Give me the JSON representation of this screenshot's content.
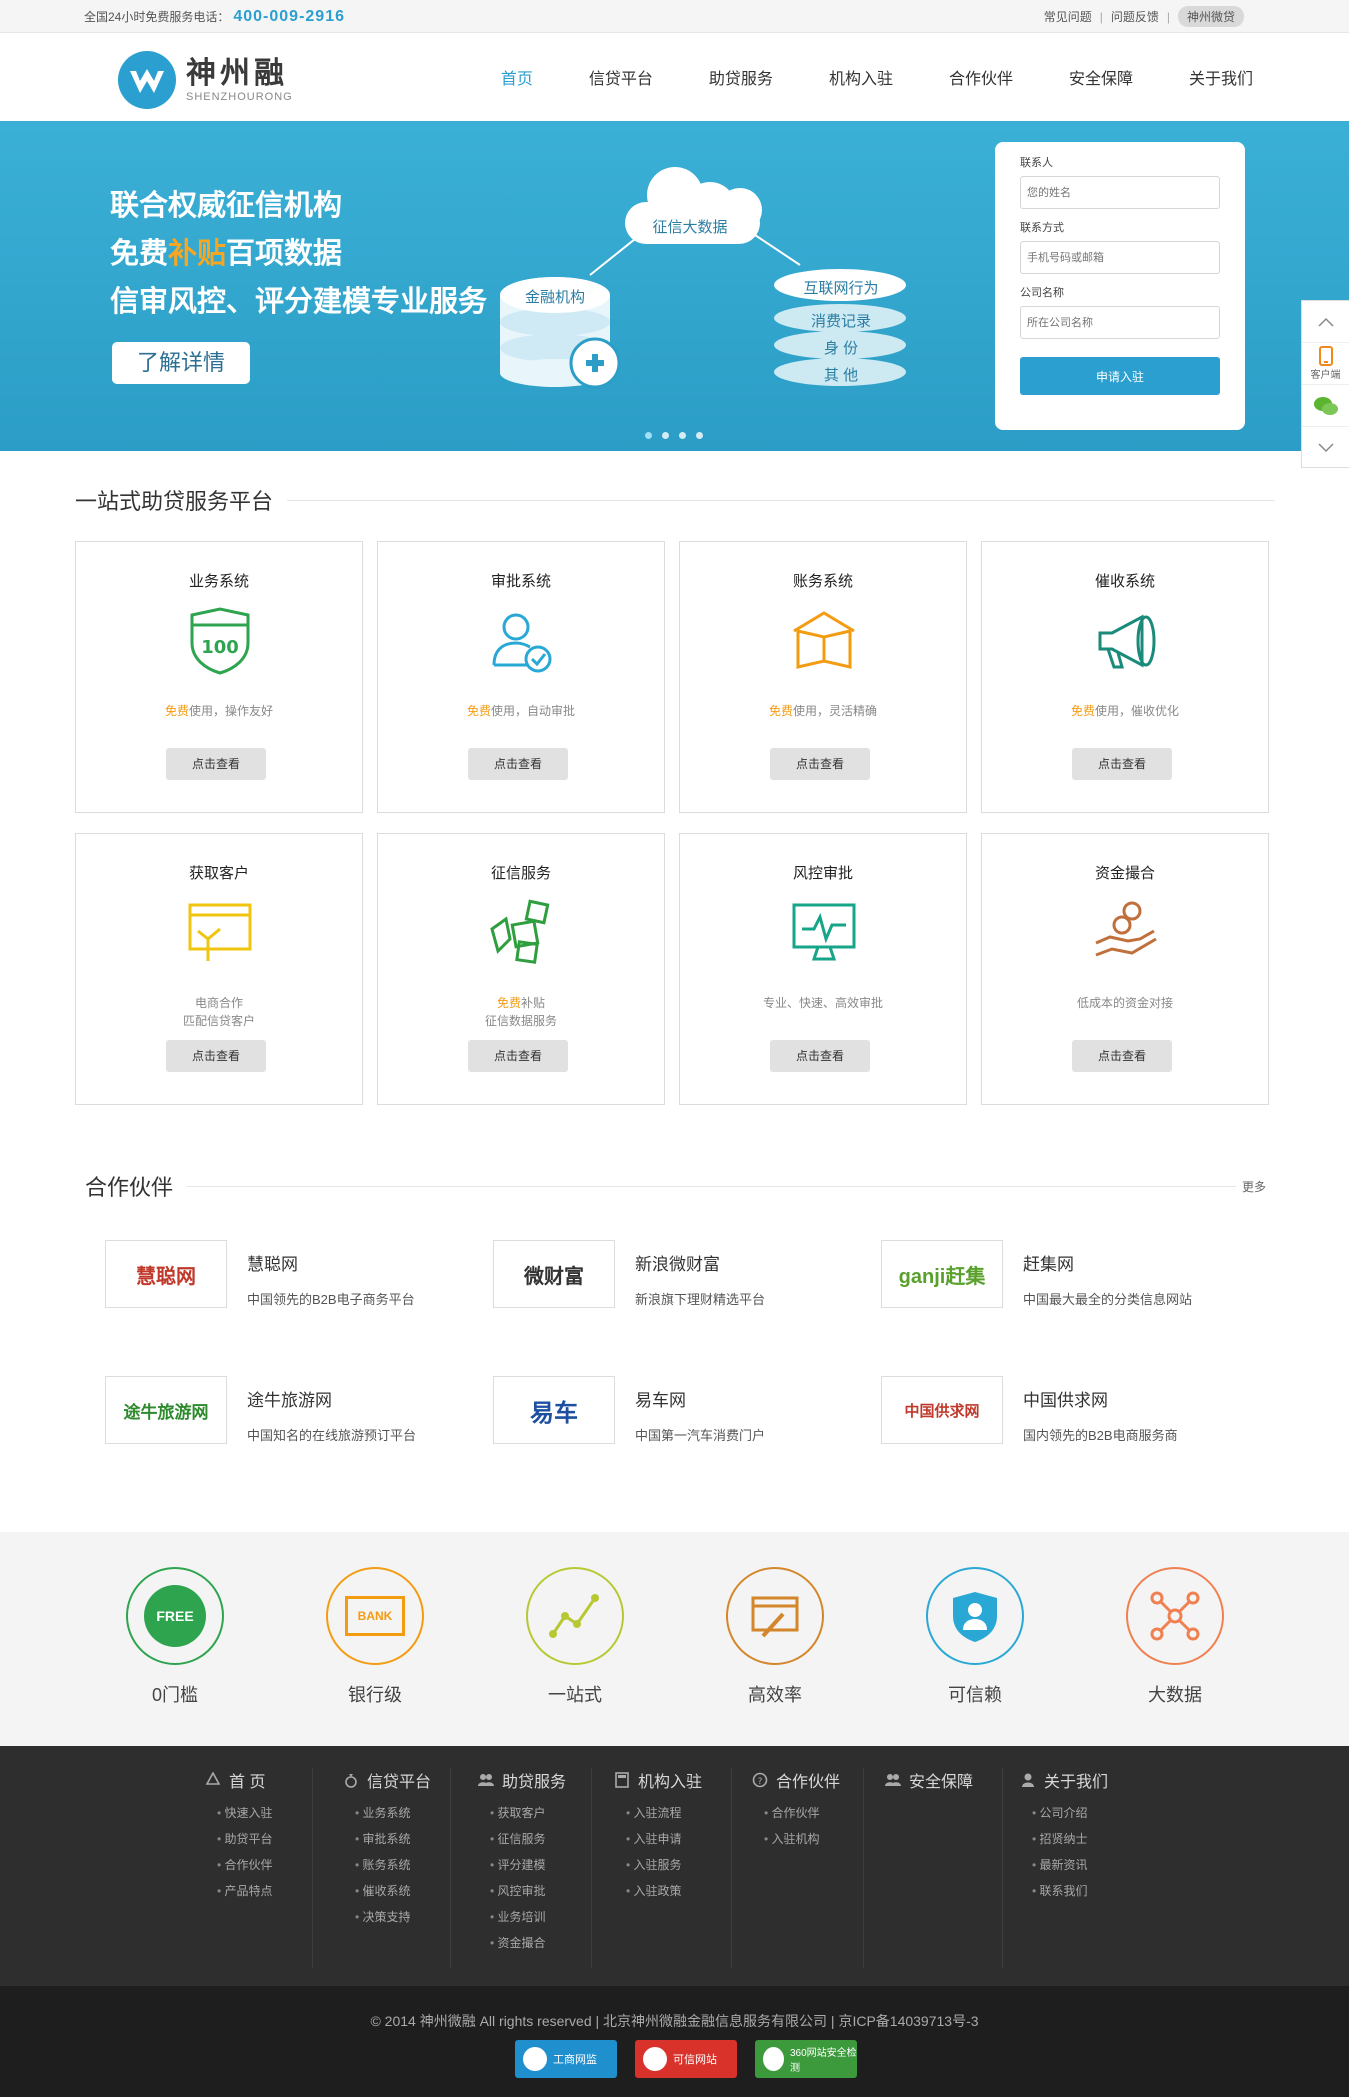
{
  "topbar": {
    "hotline_label": "全国24小时免费服务电话：",
    "hotline_number": "400-009-2916",
    "links": [
      "常见问题",
      "问题反馈"
    ],
    "pill": "神州微贷"
  },
  "header": {
    "logo_cn": "神州融",
    "logo_en": "SHENZHOURONG",
    "nav": [
      "首页",
      "信贷平台",
      "助贷服务",
      "机构入驻",
      "合作伙伴",
      "安全保障",
      "关于我们"
    ]
  },
  "banner": {
    "line1": "联合权威征信机构",
    "line2_a": "免费",
    "line2_hl": "补贴",
    "line2_b": "百项数据",
    "line3": "信审风控、评分建模专业服务",
    "more_button": "了解详情",
    "graphic": {
      "cloud": "征信大数据",
      "stack": "金融机构",
      "tags": [
        "互联网行为",
        "消费记录",
        "身 份",
        "其 他"
      ]
    }
  },
  "form": {
    "contact_label": "联系人",
    "contact_placeholder": "您的姓名",
    "phone_label": "联系方式",
    "phone_placeholder": "手机号码或邮箱",
    "company_label": "公司名称",
    "company_placeholder": "所在公司名称",
    "submit": "申请入驻"
  },
  "side": {
    "client": "客户端"
  },
  "services": {
    "title": "一站式助贷服务平台",
    "button": "点击查看",
    "free": "免费",
    "items": [
      {
        "title": "业务系统",
        "desc": "使用，操作友好",
        "free": true,
        "color": "#2ea44f"
      },
      {
        "title": "审批系统",
        "desc": "使用，自动审批",
        "free": true,
        "color": "#29a8d6"
      },
      {
        "title": "账务系统",
        "desc": "使用，灵活精确",
        "free": true,
        "color": "#f39c12"
      },
      {
        "title": "催收系统",
        "desc": "使用，催收优化",
        "free": true,
        "color": "#1a8a7a"
      },
      {
        "title": "获取客户",
        "desc": "电商合作",
        "desc2": "匹配信贷客户",
        "free": false,
        "color": "#f1c40f"
      },
      {
        "title": "征信服务",
        "desc": "补贴",
        "desc2": "征信数据服务",
        "free": true,
        "color": "#2e9e3e"
      },
      {
        "title": "风控审批",
        "desc": "专业、快速、高效审批",
        "free": false,
        "color": "#17a589"
      },
      {
        "title": "资金撮合",
        "desc": "低成本的资金对接",
        "free": false,
        "color": "#c0703a"
      }
    ]
  },
  "partners": {
    "title": "合作伙伴",
    "more": "更多",
    "items": [
      {
        "logo": "慧聪网",
        "name": "慧聪网",
        "desc": "中国领先的B2B电子商务平台",
        "color": "#c0392b"
      },
      {
        "logo": "微财富",
        "name": "新浪微财富",
        "desc": "新浪旗下理财精选平台",
        "color": "#333333"
      },
      {
        "logo": "ganji赶集",
        "name": "赶集网",
        "desc": "中国最大最全的分类信息网站",
        "color": "#5aa02c"
      },
      {
        "logo": "途牛旅游网",
        "name": "途牛旅游网",
        "desc": "中国知名的在线旅游预订平台",
        "color": "#2d8a2d"
      },
      {
        "logo": "易车",
        "name": "易车网",
        "desc": "中国第一汽车消费门户",
        "color": "#1e4fa0"
      },
      {
        "logo": "中国供求网",
        "name": "中国供求网",
        "desc": "国内领先的B2B电商服务商",
        "color": "#c0392b"
      }
    ]
  },
  "features": [
    {
      "label": "0门槛",
      "color": "#2ea44f",
      "icon_text": "FREE"
    },
    {
      "label": "银行级",
      "color": "#f39c12",
      "icon_text": "BANK"
    },
    {
      "label": "一站式",
      "color": "#b8c832",
      "icon_text": ""
    },
    {
      "label": "高效率",
      "color": "#d4862a",
      "icon_text": ""
    },
    {
      "label": "可信赖",
      "color": "#29a8d6",
      "icon_text": ""
    },
    {
      "label": "大数据",
      "color": "#f08050",
      "icon_text": ""
    }
  ],
  "footer": {
    "columns": [
      {
        "title": "首 页",
        "items": [
          "快速入驻",
          "助贷平台",
          "合作伙伴",
          "产品特点"
        ]
      },
      {
        "title": "信贷平台",
        "items": [
          "业务系统",
          "审批系统",
          "账务系统",
          "催收系统",
          "决策支持"
        ]
      },
      {
        "title": "助贷服务",
        "items": [
          "获取客户",
          "征信服务",
          "评分建模",
          "风控审批",
          "业务培训",
          "资金撮合"
        ]
      },
      {
        "title": "机构入驻",
        "items": [
          "入驻流程",
          "入驻申请",
          "入驻服务",
          "入驻政策"
        ]
      },
      {
        "title": "合作伙伴",
        "items": [
          "合作伙伴",
          "入驻机构"
        ]
      },
      {
        "title": "安全保障",
        "items": []
      },
      {
        "title": "关于我们",
        "items": [
          "公司介绍",
          "招贤纳士",
          "最新资讯",
          "联系我们"
        ]
      }
    ],
    "copyright": "© 2014 神州微融 All rights reserved  |  北京神州微融金融信息服务有限公司  |  京ICP备14039713号-3",
    "badges": [
      {
        "label": "工商网监",
        "color": "#1f8fce"
      },
      {
        "label": "可信网站",
        "color": "#d9322b"
      },
      {
        "label": "360网站安全检测",
        "color": "#3c9a3c"
      }
    ]
  }
}
